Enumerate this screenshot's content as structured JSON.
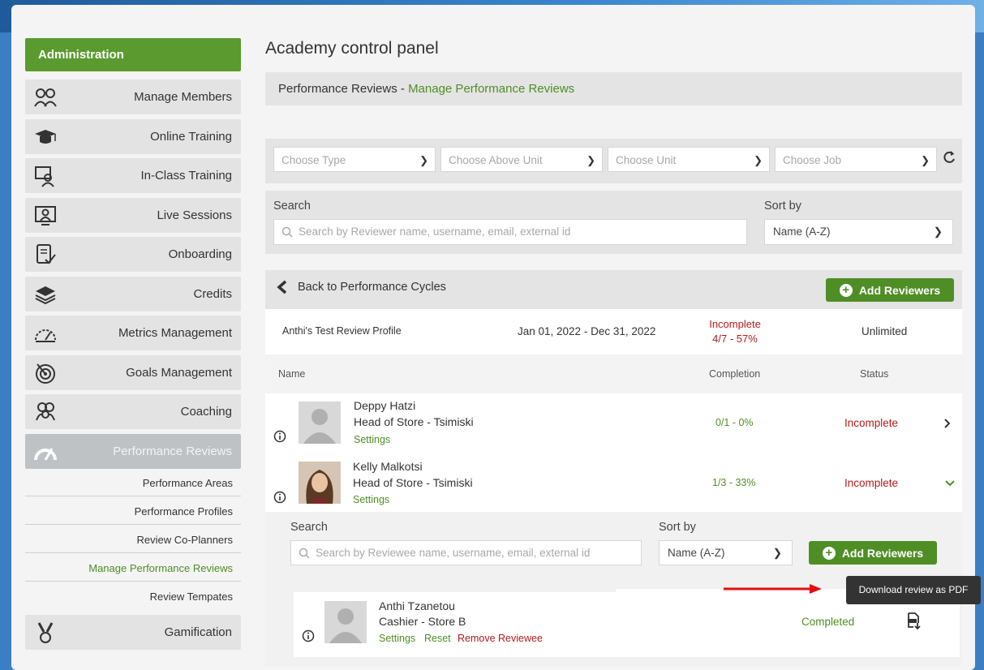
{
  "sidebar": {
    "header": "Administration",
    "items": [
      {
        "label": "Manage Members",
        "icon": "members-icon"
      },
      {
        "label": "Online Training",
        "icon": "graduation-cap-icon"
      },
      {
        "label": "In-Class Training",
        "icon": "classroom-icon"
      },
      {
        "label": "Live Sessions",
        "icon": "live-session-icon"
      },
      {
        "label": "Onboarding",
        "icon": "checklist-icon"
      },
      {
        "label": "Credits",
        "icon": "layers-icon"
      },
      {
        "label": "Metrics Management",
        "icon": "gauge-icon"
      },
      {
        "label": "Goals Management",
        "icon": "target-icon"
      },
      {
        "label": "Coaching",
        "icon": "group-icon"
      },
      {
        "label": "Performance Reviews",
        "icon": "speedometer-icon",
        "active": true
      }
    ],
    "sub_items": [
      {
        "label": "Performance Areas"
      },
      {
        "label": "Performance Profiles"
      },
      {
        "label": "Review Co-Planners"
      },
      {
        "label": "Manage Performance Reviews",
        "active": true
      },
      {
        "label": "Review Tempates"
      }
    ],
    "gamification": {
      "label": "Gamification",
      "icon": "medal-icon"
    }
  },
  "page": {
    "title": "Academy control panel",
    "breadcrumb_prefix": "Performance Reviews - ",
    "breadcrumb_link": "Manage Performance Reviews"
  },
  "filters": {
    "type_placeholder": "Choose Type",
    "above_unit_placeholder": "Choose Above Unit",
    "unit_placeholder": "Choose Unit",
    "job_placeholder": "Choose Job"
  },
  "search": {
    "label": "Search",
    "placeholder": "Search by Reviewer name, username, email, external id",
    "sort_label": "Sort by",
    "sort_value": "Name (A-Z)"
  },
  "cycle": {
    "back_label": "Back to Performance Cycles",
    "add_reviewers_label": "Add Reviewers",
    "profile_name": "Anthi's Test Review Profile",
    "date_range": "Jan 01, 2022 - Dec 31, 2022",
    "status": "Incomplete",
    "progress": "4/7 - 57%",
    "limit": "Unlimited",
    "columns": {
      "name": "Name",
      "completion": "Completion",
      "status": "Status"
    }
  },
  "reviewers": [
    {
      "name": "Deppy Hatzi",
      "role": "Head of Store - Tsimiski",
      "settings": "Settings",
      "completion": "0/1 - 0%",
      "status": "Incomplete"
    },
    {
      "name": "Kelly Malkotsi",
      "role": "Head of Store - Tsimiski",
      "settings": "Settings",
      "completion": "1/3 - 33%",
      "status": "Incomplete"
    }
  ],
  "reviewee_panel": {
    "search_label": "Search",
    "search_placeholder": "Search by Reviewee name, username, email, external id",
    "sort_label": "Sort by",
    "sort_value": "Name (A-Z)",
    "add_reviewers_label": "Add Reviewers"
  },
  "reviewee": {
    "name": "Anthi Tzanetou",
    "role": "Cashier - Store B",
    "settings": "Settings",
    "reset": "Reset",
    "remove": "Remove Reviewee",
    "status": "Completed"
  },
  "tooltip": "Download review as PDF",
  "colors": {
    "accent": "#4f8e25",
    "danger": "#b31a1a",
    "annotation_arrow": "#e01010"
  }
}
